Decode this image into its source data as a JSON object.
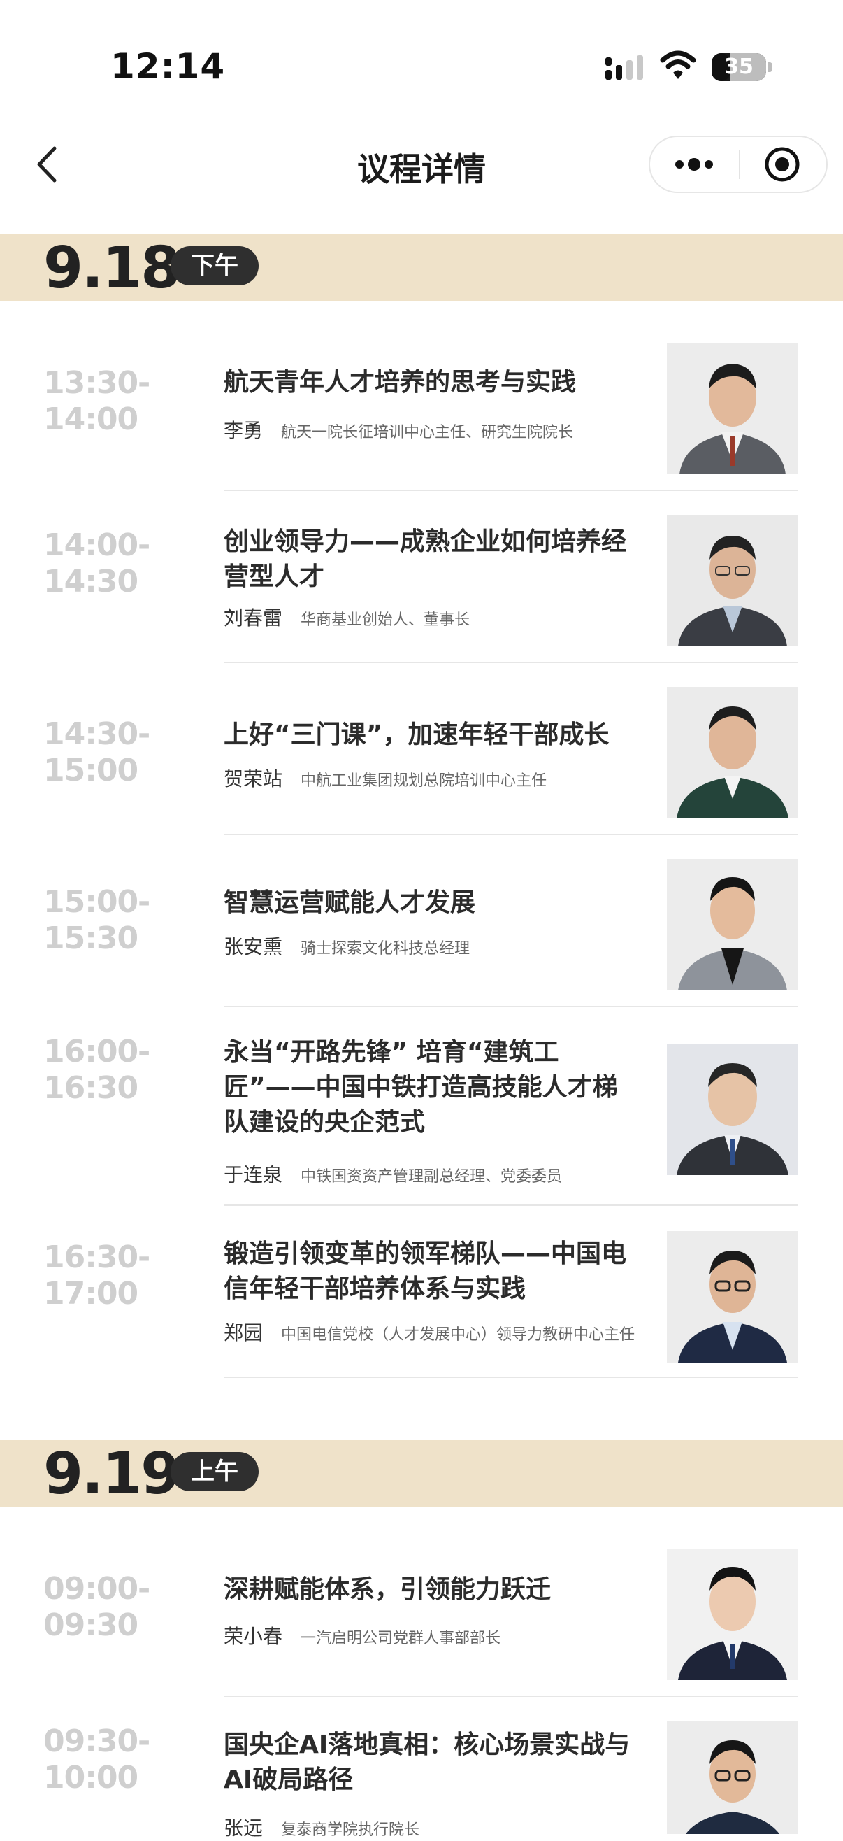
{
  "status": {
    "time": "12:14",
    "battery": "35",
    "battery_level": 0.35
  },
  "nav": {
    "title": "议程详情"
  },
  "sections": [
    {
      "date": "9.18",
      "period": "下午",
      "items": [
        {
          "start": "13:30-",
          "end": "14:00",
          "title": "航天青年人才培养的思考与实践",
          "speaker": "李勇",
          "role": "航天一院长征培训中心主任、研究生院院长"
        },
        {
          "start": "14:00-",
          "end": "14:30",
          "title": "创业领导力——成熟企业如何培养经营型人才",
          "speaker": "刘春雷",
          "role": "华商基业创始人、董事长"
        },
        {
          "start": "14:30-",
          "end": "15:00",
          "title": "上好“三门课”，加速年轻干部成长",
          "speaker": "贺荣站",
          "role": "中航工业集团规划总院培训中心主任"
        },
        {
          "start": "15:00-",
          "end": "15:30",
          "title": "智慧运营赋能人才发展",
          "speaker": "张安熏",
          "role": "骑士探索文化科技总经理"
        },
        {
          "start": "16:00-",
          "end": "16:30",
          "title": "永当“开路先锋” 培育“建筑工匠”——中国中铁打造高技能人才梯队建设的央企范式",
          "speaker": "于连泉",
          "role": "中铁国资资产管理副总经理、党委委员"
        },
        {
          "start": "16:30-",
          "end": "17:00",
          "title": "锻造引领变革的领军梯队——中国电信年轻干部培养体系与实践",
          "speaker": "郑园",
          "role": "中国电信党校（人才发展中心）领导力教研中心主任"
        }
      ]
    },
    {
      "date": "9.19",
      "period": "上午",
      "items": [
        {
          "start": "09:00-",
          "end": "09:30",
          "title": "深耕赋能体系，引领能力跃迁",
          "speaker": "荣小春",
          "role": "一汽启明公司党群人事部部长"
        },
        {
          "start": "09:30-",
          "end": "10:00",
          "title": "国央企AI落地真相：核心场景实战与AI破局路径",
          "speaker": "张远",
          "role": "复泰商学院执行院长"
        }
      ]
    }
  ]
}
